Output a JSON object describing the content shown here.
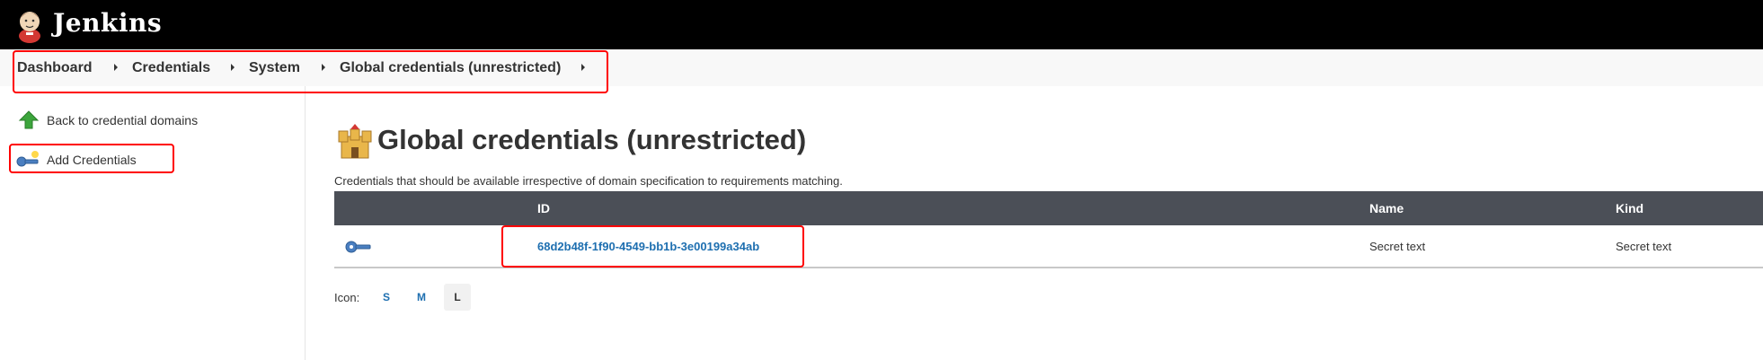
{
  "header": {
    "app_title": "Jenkins",
    "logo_icon": "jenkins-butler-icon"
  },
  "breadcrumb": {
    "items": [
      {
        "label": "Dashboard"
      },
      {
        "label": "Credentials"
      },
      {
        "label": "System"
      },
      {
        "label": "Global credentials (unrestricted)"
      }
    ]
  },
  "sidebar": {
    "items": [
      {
        "label": "Back to credential domains",
        "icon": "green-up-arrow-icon"
      },
      {
        "label": "Add Credentials",
        "icon": "key-add-icon"
      }
    ]
  },
  "main": {
    "title": "Global credentials (unrestricted)",
    "title_icon": "castle-icon",
    "description": "Credentials that should be available irrespective of domain specification to requirements matching.",
    "table": {
      "columns": [
        "ID",
        "Name",
        "Kind"
      ],
      "rows": [
        {
          "icon": "key-icon",
          "id": "68d2b48f-1f90-4549-bb1b-3e00199a34ab",
          "name": "Secret text",
          "kind": "Secret text"
        }
      ]
    },
    "icon_size": {
      "label": "Icon:",
      "options": [
        "S",
        "M",
        "L"
      ],
      "selected": "L"
    }
  },
  "colors": {
    "header_bg": "#000000",
    "table_header_bg": "#4b4f57",
    "link": "#1e6fb0",
    "annotation": "#ff0000"
  }
}
